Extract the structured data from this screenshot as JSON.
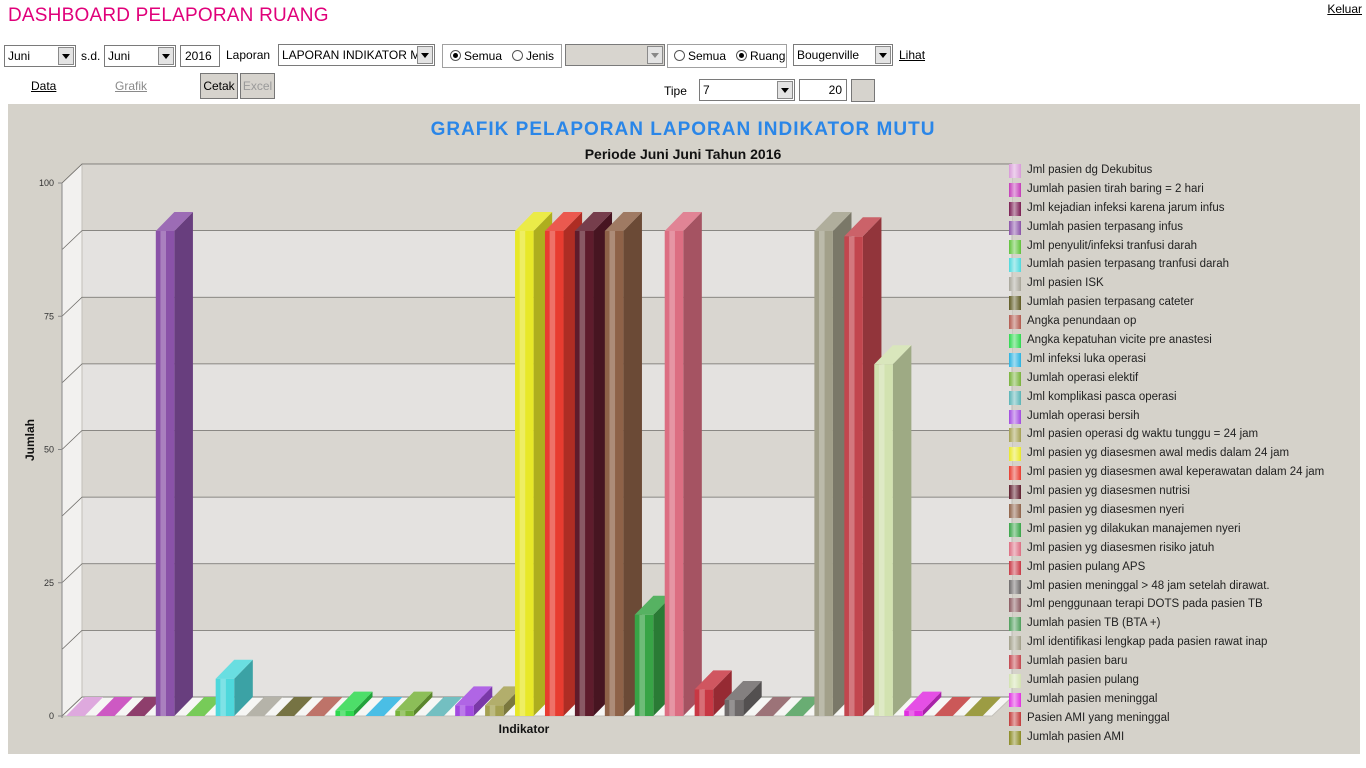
{
  "header": {
    "title": "DASHBOARD PELAPORAN RUANG",
    "logout": "Keluar"
  },
  "filters": {
    "month_from": "Juni",
    "sd_label": "s.d.",
    "month_to": "Juni",
    "year": "2016",
    "report_label": "Laporan",
    "report_value": "LAPORAN INDIKATOR M",
    "type_group": {
      "option1": "Semua",
      "option2": "Jenis",
      "selected": "Semua"
    },
    "jenis_value": "",
    "scope_group": {
      "option1": "Semua",
      "option2": "Ruang",
      "selected": "Ruang"
    },
    "room_value": "Bougenville",
    "view_label": "Lihat"
  },
  "tabs": {
    "data": "Data",
    "grafik": "Grafik"
  },
  "buttons": {
    "print": "Cetak",
    "excel": "Excel"
  },
  "tipe": {
    "label": "Tipe",
    "value": "7",
    "count": "20",
    "button": ""
  },
  "chart_data": {
    "type": "bar",
    "title": "GRAFIK PELAPORAN LAPORAN INDIKATOR MUTU",
    "subtitle": "Periode Juni Juni Tahun 2016",
    "xlabel": "Indikator",
    "ylabel": "Jumlah",
    "ylim": [
      0,
      100
    ],
    "yticks": [
      0,
      25,
      50,
      75,
      100
    ],
    "grid": true,
    "legend_position": "right",
    "series": [
      {
        "name": "Jml pasien dg Dekubitus",
        "value": 0,
        "color": "#d89ad8"
      },
      {
        "name": "Jumlah pasien tirah baring = 2 hari",
        "value": 0,
        "color": "#c43cb8"
      },
      {
        "name": "Jml kejadian infeksi karena jarum infus",
        "value": 0,
        "color": "#7a1c52"
      },
      {
        "name": "Jumlah pasien terpasang infus",
        "value": 91,
        "color": "#8a52a8"
      },
      {
        "name": "Jml penyulit/infeksi tranfusi darah",
        "value": 0,
        "color": "#5fc23a"
      },
      {
        "name": "Jumlah pasien terpasang tranfusi darah",
        "value": 7,
        "color": "#4ed8dc"
      },
      {
        "name": "Jml pasien ISK",
        "value": 0,
        "color": "#a8a69a"
      },
      {
        "name": "Jumlah pasien terpasang cateter",
        "value": 0,
        "color": "#5e5a22"
      },
      {
        "name": "Angka penundaan op",
        "value": 0,
        "color": "#b25a4e"
      },
      {
        "name": "Angka kepatuhan vicite pre anastesi",
        "value": 1,
        "color": "#2ed84e"
      },
      {
        "name": "Jml infeksi luka operasi",
        "value": 0,
        "color": "#2ab2e0"
      },
      {
        "name": "Jumlah operasi elektif",
        "value": 1,
        "color": "#78b23a"
      },
      {
        "name": "Jml komplikasi pasca operasi",
        "value": 0,
        "color": "#5ab4b6"
      },
      {
        "name": "Jumlah operasi bersih",
        "value": 2,
        "color": "#a24ae0"
      },
      {
        "name": "Jml pasien operasi dg waktu tunggu  = 24 jam",
        "value": 2,
        "color": "#a4a052"
      },
      {
        "name": "Jml pasien yg diasesmen awal medis dalam 24 jam",
        "value": 91,
        "color": "#e8e828"
      },
      {
        "name": "Jml pasien yg diasesmen awal keperawatan dalam 24 jam",
        "value": 91,
        "color": "#e83c30"
      },
      {
        "name": "Jml pasien yg diasesmen nutrisi",
        "value": 91,
        "color": "#5e1c2c"
      },
      {
        "name": "Jml pasien yg diasesmen nyeri",
        "value": 91,
        "color": "#8e6248"
      },
      {
        "name": "Jml pasien yg dilakukan manajemen nyeri",
        "value": 19,
        "color": "#38a446"
      },
      {
        "name": "Jml pasien yg diasesmen risiko jatuh",
        "value": 91,
        "color": "#dc6e82"
      },
      {
        "name": "Jml pasien pulang APS",
        "value": 5,
        "color": "#c83844"
      },
      {
        "name": "Jml pasien meninggal  > 48 jam setelah dirawat.",
        "value": 3,
        "color": "#6e6a6a"
      },
      {
        "name": "Jml penggunaan terapi DOTS pada pasien TB",
        "value": 0,
        "color": "#8a5a60"
      },
      {
        "name": "Jumlah pasien TB (BTA +)",
        "value": 0,
        "color": "#4e9e5a"
      },
      {
        "name": "Jml  identifikasi lengkap pada pasien rawat inap",
        "value": 91,
        "color": "#a2a08a"
      },
      {
        "name": "Jumlah pasien baru",
        "value": 90,
        "color": "#c2464e"
      },
      {
        "name": "Jumlah pasien pulang",
        "value": 66,
        "color": "#d2e2b0"
      },
      {
        "name": "Jumlah pasien meninggal",
        "value": 1,
        "color": "#e030e0"
      },
      {
        "name": "Pasien AMI yang meninggal",
        "value": 0,
        "color": "#c23a3a"
      },
      {
        "name": "Jumlah pasien AMI",
        "value": 0,
        "color": "#8a8a22"
      }
    ]
  }
}
